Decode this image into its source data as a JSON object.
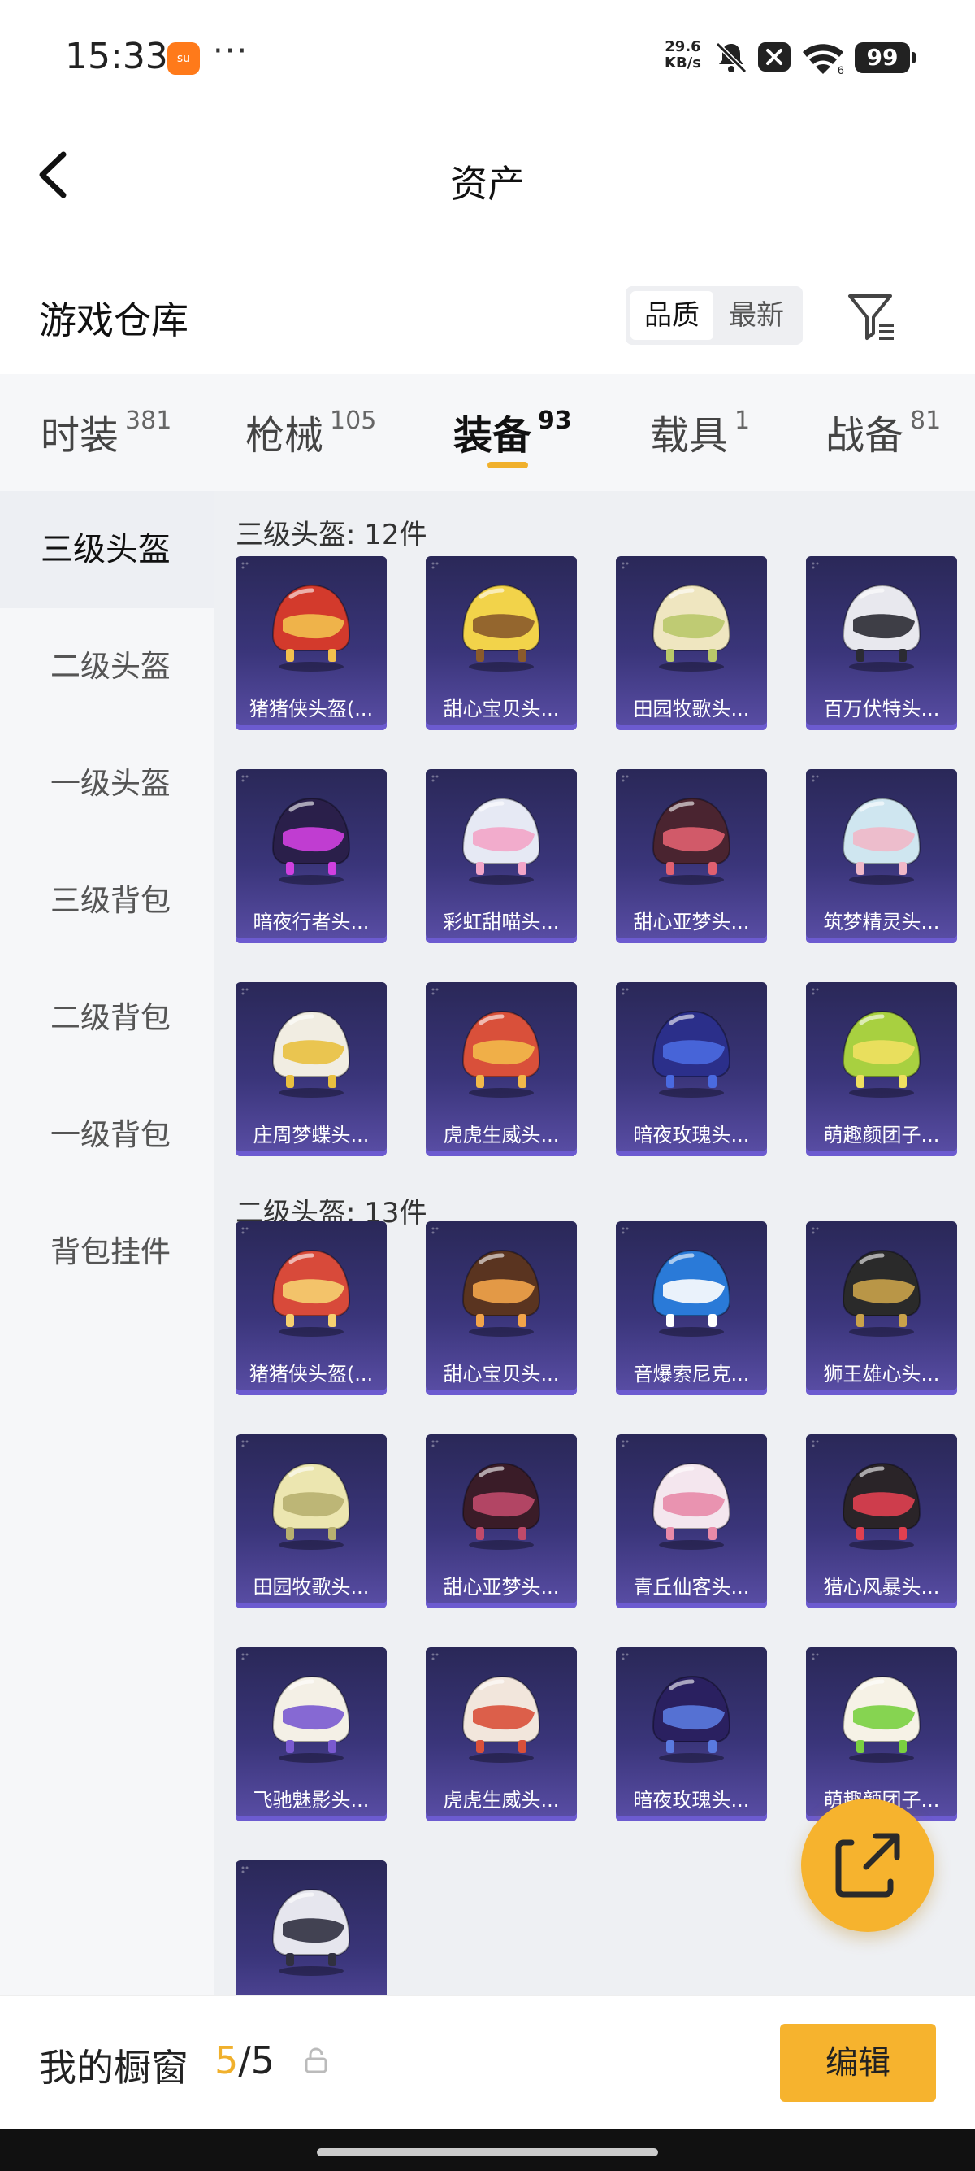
{
  "status_bar": {
    "time": "15:33",
    "app_badge": "su",
    "more": "···",
    "net_speed_value": "29.6",
    "net_speed_unit": "KB/s",
    "wifi_sub": "6",
    "battery": "99"
  },
  "nav": {
    "title": "资产"
  },
  "header": {
    "title": "游戏仓库",
    "sort_options": [
      "品质",
      "最新"
    ],
    "selected_sort": "品质"
  },
  "tabs": [
    {
      "label": "时装",
      "count": "381"
    },
    {
      "label": "枪械",
      "count": "105"
    },
    {
      "label": "装备",
      "count": "93",
      "active": true
    },
    {
      "label": "载具",
      "count": "1"
    },
    {
      "label": "战备",
      "count": "81"
    }
  ],
  "sidebar": {
    "items": [
      "三级头盔",
      "二级头盔",
      "一级头盔",
      "三级背包",
      "二级背包",
      "一级背包",
      "背包挂件"
    ],
    "active": "三级头盔"
  },
  "groups": [
    {
      "title": "三级头盔: 12件",
      "items": [
        {
          "name": "猪猪侠头盔(...",
          "color": "#d33a2c",
          "accent": "#f2c14e"
        },
        {
          "name": "甜心宝贝头...",
          "color": "#f2d34a",
          "accent": "#8a5a2b"
        },
        {
          "name": "田园牧歌头...",
          "color": "#efe6c0",
          "accent": "#b9c86a"
        },
        {
          "name": "百万伏特头...",
          "color": "#e8e8ee",
          "accent": "#2b2b33"
        },
        {
          "name": "暗夜行者头...",
          "color": "#2a1f4a",
          "accent": "#d040e0"
        },
        {
          "name": "彩虹甜喵头...",
          "color": "#e6e9f4",
          "accent": "#f3a5c8"
        },
        {
          "name": "甜心亚梦头...",
          "color": "#4a2430",
          "accent": "#e06070"
        },
        {
          "name": "筑梦精灵头...",
          "color": "#cfe6f0",
          "accent": "#f0b8c8"
        },
        {
          "name": "庄周梦蝶头...",
          "color": "#f1ede2",
          "accent": "#e9c040"
        },
        {
          "name": "虎虎生威头...",
          "color": "#d9503a",
          "accent": "#f2b94a"
        },
        {
          "name": "暗夜玫瑰头...",
          "color": "#2b2f8a",
          "accent": "#4a6ae0"
        },
        {
          "name": "萌趣颜团子...",
          "color": "#a8d040",
          "accent": "#f0e060"
        }
      ]
    },
    {
      "title": "二级头盔: 13件",
      "items": [
        {
          "name": "猪猪侠头盔(...",
          "color": "#d84a3a",
          "accent": "#f6d070"
        },
        {
          "name": "甜心宝贝头...",
          "color": "#5a3420",
          "accent": "#f2a44a"
        },
        {
          "name": "音爆索尼克...",
          "color": "#2a7ad8",
          "accent": "#ffffff"
        },
        {
          "name": "狮王雄心头...",
          "color": "#2a2a2a",
          "accent": "#c9a24a"
        },
        {
          "name": "田园牧歌头...",
          "color": "#ece6b0",
          "accent": "#b8b070"
        },
        {
          "name": "甜心亚梦头...",
          "color": "#3a1c28",
          "accent": "#c04a6a"
        },
        {
          "name": "青丘仙客头...",
          "color": "#f4e6ee",
          "accent": "#e88aa8"
        },
        {
          "name": "猎心风暴头...",
          "color": "#2a2428",
          "accent": "#e04050"
        },
        {
          "name": "飞驰魅影头...",
          "color": "#f4f0e6",
          "accent": "#7a5ad0"
        },
        {
          "name": "虎虎生威头...",
          "color": "#f2e6dc",
          "accent": "#d9503a"
        },
        {
          "name": "暗夜玫瑰头...",
          "color": "#2a2060",
          "accent": "#5a7ae0"
        },
        {
          "name": "萌趣颜团子...",
          "color": "#f6f2e6",
          "accent": "#7ad040"
        },
        {
          "name": "",
          "color": "#e6e6ee",
          "accent": "#303040"
        }
      ]
    }
  ],
  "bottom_bar": {
    "label": "我的橱窗",
    "current": "5",
    "separator": "/",
    "total": "5",
    "edit_label": "编辑"
  },
  "colors": {
    "accent": "#f6b32e",
    "card_bg": "#3a357a"
  },
  "icons": {
    "back": "chevron-left-icon",
    "filter": "filter-list-icon",
    "fab": "share-external-icon",
    "lock": "lock-open-icon"
  }
}
